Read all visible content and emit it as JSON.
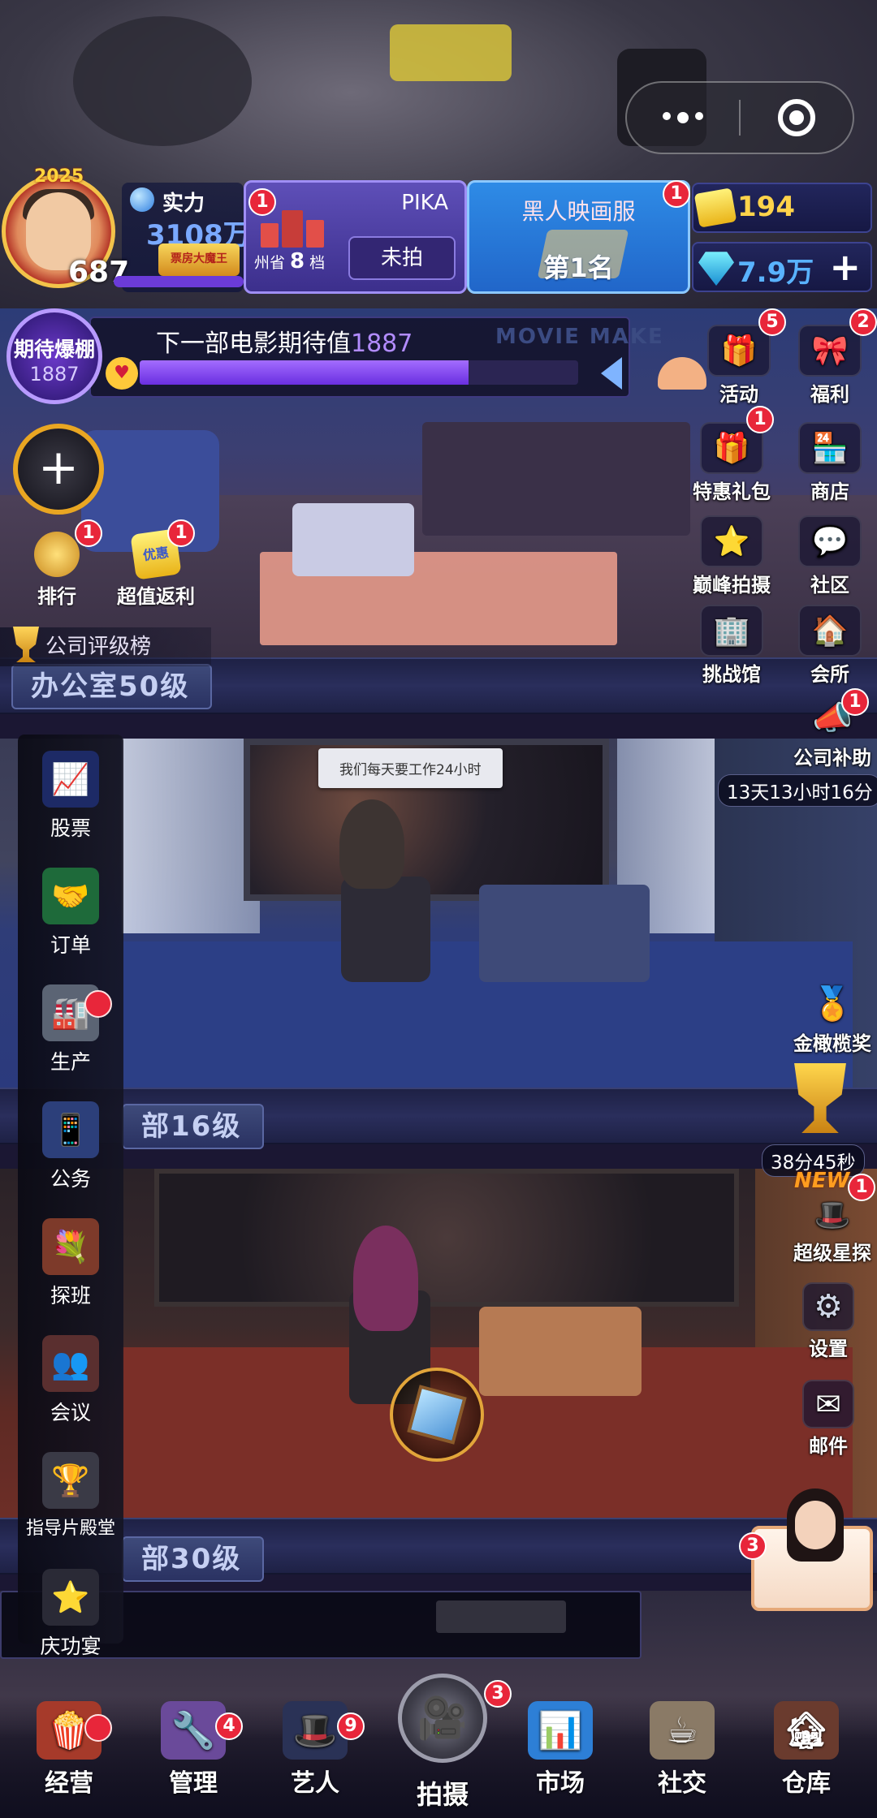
{
  "top_capsule": {
    "more": "more",
    "close": "close"
  },
  "profile": {
    "year_badge": "2025",
    "level": "687",
    "power_label": "实力",
    "power_value": "3108万",
    "title_badge": "票房大魔王"
  },
  "province": {
    "title": "PIKA",
    "sub_prefix": "州省",
    "sub_number": "8",
    "sub_suffix": "档",
    "status_button": "未拍",
    "badge": "1"
  },
  "ranking": {
    "title": "黑人映画服",
    "value": "第1名",
    "badge": "1"
  },
  "currency": {
    "gold": "194",
    "gems": "7.9万",
    "add": "+"
  },
  "expectation": {
    "circle_title": "期待爆棚",
    "circle_value": "1887",
    "label": "下一部电影期待值",
    "value": "1887",
    "progress": 0.75,
    "sign": "MOVIE MAKE"
  },
  "left_actions": {
    "add": "+",
    "rank": {
      "label": "排行",
      "badge": "1"
    },
    "rebate": {
      "label": "超值返利",
      "badge": "1",
      "icon_text": "优惠"
    },
    "rating_list": "公司评级榜"
  },
  "right_buttons": [
    {
      "name": "activity",
      "label": "活动",
      "badge": "5",
      "icon": "🎁"
    },
    {
      "name": "welfare",
      "label": "福利",
      "badge": "2",
      "icon": "🎀"
    },
    {
      "name": "gift-pack",
      "label": "特惠礼包",
      "badge": "1",
      "icon": "🎁"
    },
    {
      "name": "shop",
      "label": "商店",
      "badge": "",
      "icon": "🏪"
    },
    {
      "name": "peak-shoot",
      "label": "巅峰拍摄",
      "badge": "",
      "icon": "⭐"
    },
    {
      "name": "community",
      "label": "社区",
      "badge": "",
      "icon": "💬"
    },
    {
      "name": "challenge",
      "label": "挑战馆",
      "badge": "",
      "icon": "🏢"
    },
    {
      "name": "club",
      "label": "会所",
      "badge": "",
      "icon": "🏠"
    }
  ],
  "subsidy": {
    "label": "公司补助",
    "timer": "13天13小时16分",
    "badge": "1"
  },
  "golden_olive": {
    "label": "金橄榄奖"
  },
  "trophy_timer": "38分45秒",
  "super_scout": {
    "new_tag": "NEW",
    "label": "超级星探",
    "badge": "1"
  },
  "settings": {
    "label": "设置"
  },
  "mail": {
    "label": "邮件"
  },
  "secretary": {
    "badge": "3"
  },
  "floors": {
    "office": "办公室50级",
    "dept2": "部16级",
    "dept3": "部30级"
  },
  "speech_bubble": "我们每天要工作24小时",
  "side_menu": [
    {
      "name": "stocks",
      "label": "股票",
      "icon": "📈"
    },
    {
      "name": "orders",
      "label": "订单",
      "icon": "🤝"
    },
    {
      "name": "production",
      "label": "生产",
      "icon": "🏭"
    },
    {
      "name": "business",
      "label": "公务",
      "icon": "📱"
    },
    {
      "name": "set-visit",
      "label": "探班",
      "icon": "💐"
    },
    {
      "name": "meeting",
      "label": "会议",
      "icon": "👥"
    },
    {
      "name": "director-hall",
      "label": "指导片殿堂",
      "icon": "🏆"
    },
    {
      "name": "celebration",
      "label": "庆功宴",
      "icon": "⭐"
    }
  ],
  "bottom_nav": [
    {
      "name": "operate",
      "label": "经营",
      "badge": "",
      "icon": "🍿"
    },
    {
      "name": "manage",
      "label": "管理",
      "badge": "4",
      "icon": "🔧"
    },
    {
      "name": "artists",
      "label": "艺人",
      "badge": "9",
      "icon": "🎩"
    },
    {
      "name": "shoot",
      "label": "拍摄",
      "badge": "3",
      "icon": "🎥"
    },
    {
      "name": "market",
      "label": "市场",
      "badge": "",
      "icon": "📊"
    },
    {
      "name": "social",
      "label": "社交",
      "badge": "",
      "icon": "☕"
    },
    {
      "name": "warehouse",
      "label": "仓库",
      "badge": "",
      "icon": "🏚"
    }
  ],
  "colors": {
    "badge_red": "#e8263a",
    "gold_text": "#ffd34a",
    "gem_text": "#59b2ff",
    "progress_purple": "#8a4cf0"
  }
}
